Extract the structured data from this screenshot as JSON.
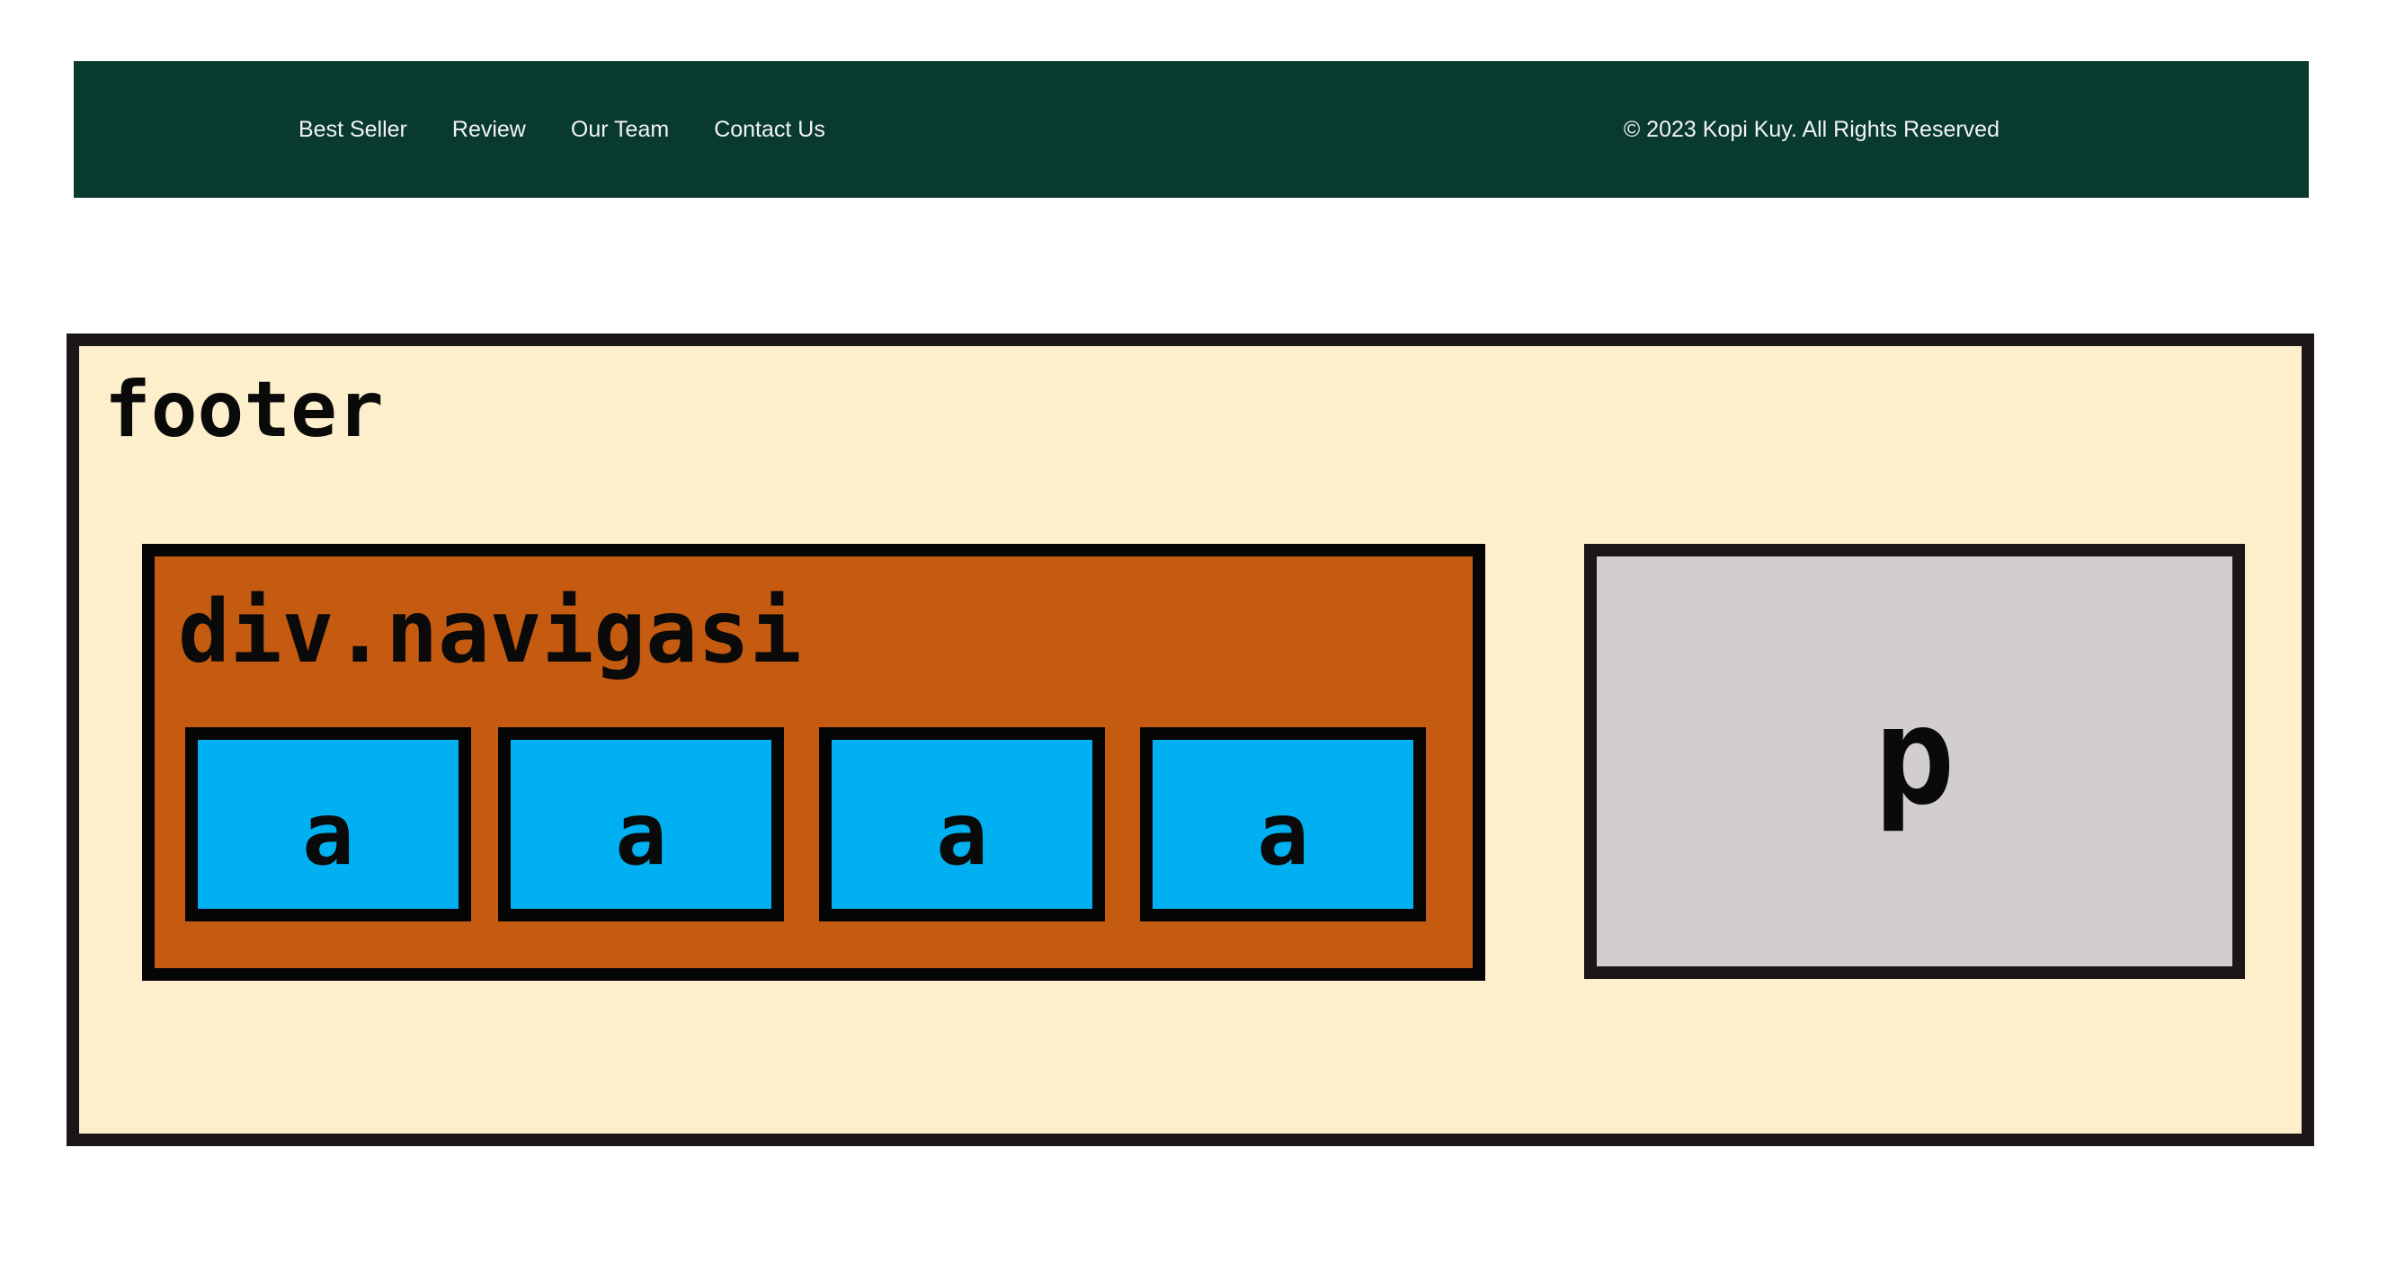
{
  "site_footer": {
    "background_color": "#093a2f",
    "nav_links": [
      "Best Seller",
      "Review",
      "Our Team",
      "Contact Us"
    ],
    "copyright": "© 2023 Kopi Kuy. All Rights Reserved"
  },
  "diagram": {
    "footer": {
      "label": "footer",
      "color": "#fdefcb"
    },
    "navigasi": {
      "label": "div.navigasi",
      "color": "#c45b11"
    },
    "anchors": {
      "labels": [
        "a",
        "a",
        "a",
        "a"
      ],
      "color": "#00b0f0"
    },
    "paragraph": {
      "label": "p",
      "color": "#d2cecf"
    }
  }
}
